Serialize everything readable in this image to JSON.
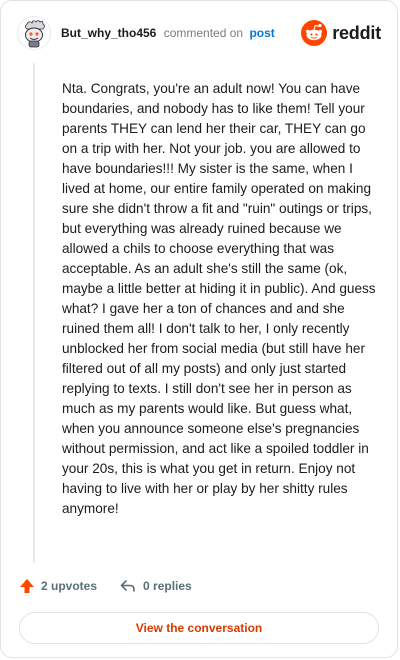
{
  "header": {
    "username": "But_why_tho456",
    "commented": "commented on",
    "post_link": "post",
    "brand": "reddit"
  },
  "comment": {
    "text": "Nta. Congrats, you're an adult now! You can have boundaries, and nobody has to like them! Tell your parents THEY can lend her their car, THEY can go on a trip with her. Not your job. you are allowed to have boundaries!!! My sister is the same, when I lived at home, our entire family operated on making sure she didn't throw a fit and \"ruin\" outings or trips, but everything was already ruined because we allowed a chils to choose everything that was acceptable. As an adult she's still the same (ok, maybe a little better at hiding it in public). And guess what? I gave her a ton of chances and and she ruined them all! I don't talk to her, I only recently unblocked her from social media (but still have her filtered out of all my posts) and only just started replying to texts. I still don't see her in person as much as my parents would like. But guess what, when you announce someone else's pregnancies without permission, and act like a spoiled toddler in your 20s, this is what you get in return. Enjoy not having to live with her or play by her shitty rules anymore!"
  },
  "actions": {
    "upvotes": "2 upvotes",
    "replies": "0 replies"
  },
  "cta": {
    "label": "View the conversation"
  },
  "icons": {
    "upvote": "upvote-arrow-icon",
    "reply": "reply-arrow-icon",
    "avatar": "snoo-avatar-icon",
    "brand": "reddit-logo-icon"
  },
  "colors": {
    "brand_orange": "#ff4500",
    "link_blue": "#0079d3",
    "cta_text": "#d93a00",
    "muted": "#576f76"
  }
}
